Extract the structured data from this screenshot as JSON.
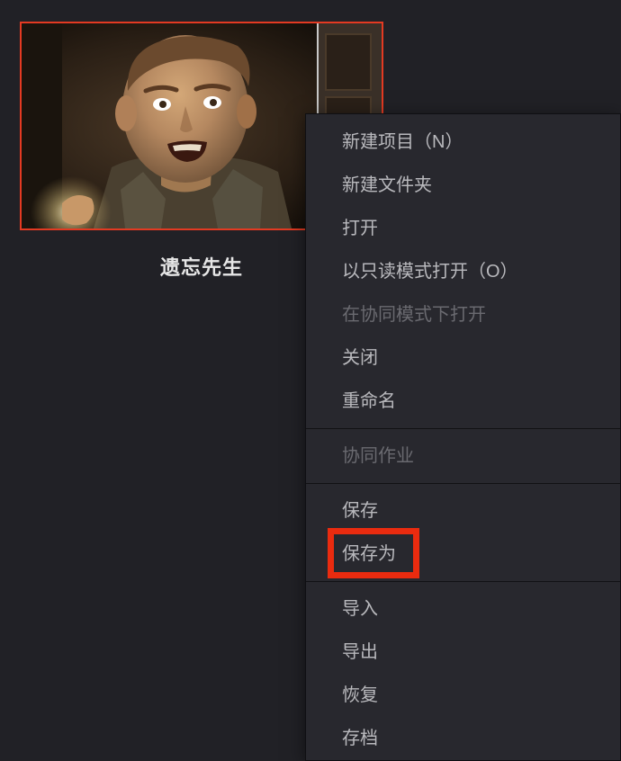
{
  "thumbnail": {
    "label": "遗忘先生"
  },
  "context_menu": {
    "groups": [
      [
        {
          "label": "新建项目（N）",
          "enabled": true
        },
        {
          "label": "新建文件夹",
          "enabled": true
        },
        {
          "label": "打开",
          "enabled": true
        },
        {
          "label": "以只读模式打开（O）",
          "enabled": true
        },
        {
          "label": "在协同模式下打开",
          "enabled": false
        },
        {
          "label": "关闭",
          "enabled": true
        },
        {
          "label": "重命名",
          "enabled": true
        }
      ],
      [
        {
          "label": "协同作业",
          "enabled": false
        }
      ],
      [
        {
          "label": "保存",
          "enabled": true
        },
        {
          "label": "保存为",
          "enabled": true
        }
      ],
      [
        {
          "label": "导入",
          "enabled": true
        },
        {
          "label": "导出",
          "enabled": true,
          "highlighted": true
        },
        {
          "label": "恢复",
          "enabled": true
        },
        {
          "label": "存档",
          "enabled": true
        }
      ]
    ]
  }
}
